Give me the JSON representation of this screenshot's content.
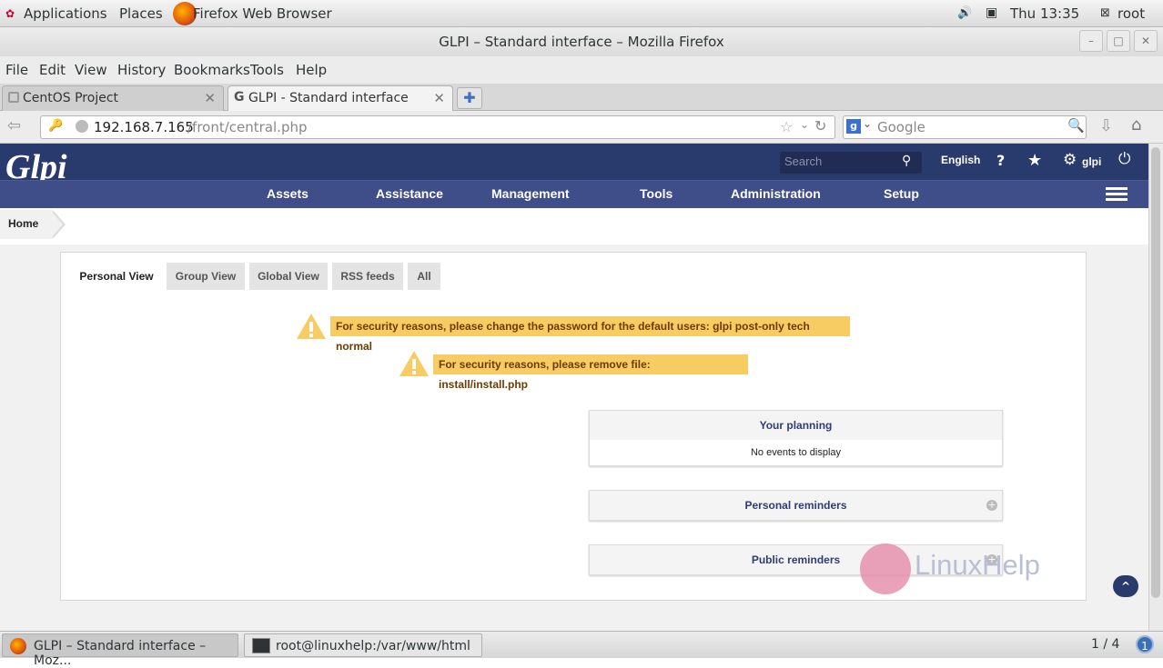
{
  "desktop": {
    "applications": "Applications",
    "places": "Places",
    "app_name": "Firefox Web Browser",
    "clock": "Thu 13:35",
    "user": "root"
  },
  "window": {
    "title": "GLPI – Standard interface – Mozilla Firefox"
  },
  "menu": [
    "File",
    "Edit",
    "View",
    "History",
    "Bookmarks",
    "Tools",
    "Help"
  ],
  "tabs": [
    {
      "label": "CentOS Project"
    },
    {
      "label": "GLPI - Standard interface"
    }
  ],
  "nav": {
    "url_host": "192.168.7.165",
    "url_path": "/front/central.php",
    "search_placeholder": "Google"
  },
  "glpi": {
    "logo": "Glpi",
    "search_placeholder": "Search",
    "language": "English",
    "user": "glpi",
    "mainmenu": [
      "Assets",
      "Assistance",
      "Management",
      "Tools",
      "Administration",
      "Setup"
    ],
    "breadcrumb": "Home",
    "view_tabs": [
      "Personal View",
      "Group View",
      "Global View",
      "RSS feeds",
      "All"
    ],
    "warnings": [
      "For security reasons, please change the password for the default users: glpi post-only tech normal",
      "For security reasons, please remove file: install/install.php"
    ],
    "planning_title": "Your planning",
    "planning_empty": "No events to display",
    "personal_reminders": "Personal reminders",
    "public_reminders": "Public reminders",
    "watermark": "LinuxHelp",
    "back_to_top": "^"
  },
  "taskbar": {
    "items": [
      {
        "label": "GLPI – Standard interface – Moz..."
      },
      {
        "label": "root@linuxhelp:/var/www/html"
      }
    ],
    "workspace": "1 / 4",
    "notification": "1"
  },
  "colors": {
    "glpi_header": "#293a6d",
    "glpi_menu": "#3f4e88",
    "warning": "#f7cc63"
  }
}
